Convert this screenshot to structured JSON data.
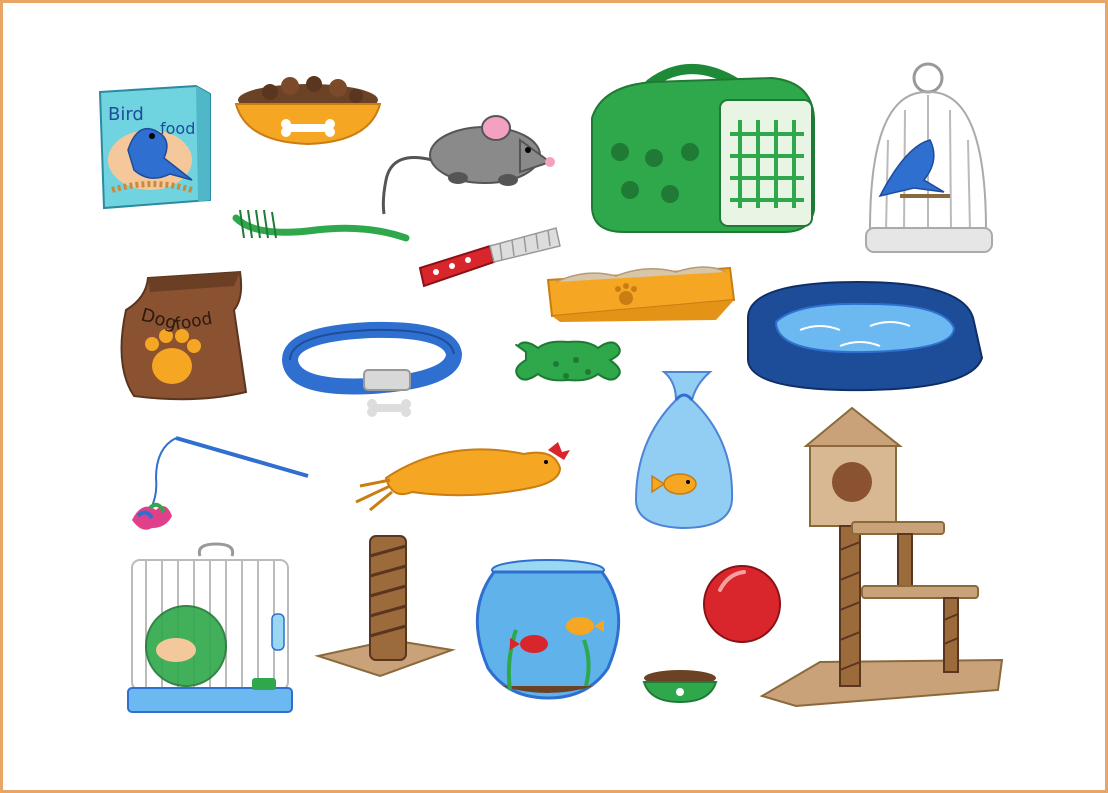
{
  "labels": {
    "bird_food_line1": "Bird",
    "bird_food_line2": "food",
    "dog_food_line1": "Dog",
    "dog_food_line2": "food"
  },
  "colors": {
    "frame": "#e8a565",
    "background": "#ffffff",
    "blue": "#2f6fd0",
    "green": "#2ea84a",
    "brown": "#7a4a2a",
    "tan": "#c9a27a",
    "orange": "#f5a623",
    "red": "#d9262c"
  }
}
